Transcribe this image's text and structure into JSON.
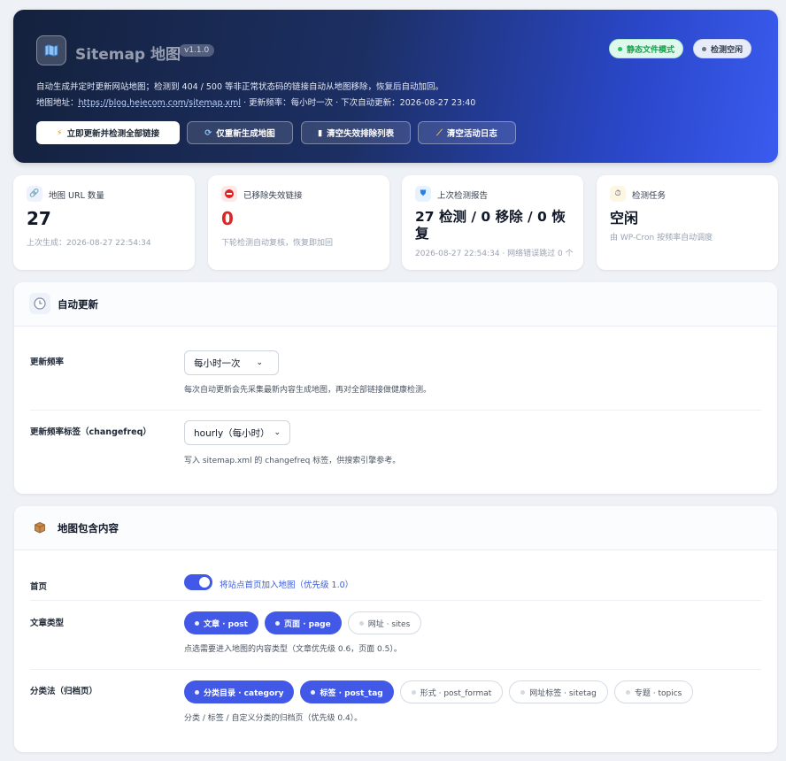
{
  "hero": {
    "title": "Sitemap 地图",
    "version": "v1.1.0",
    "badge_static": "静态文件模式",
    "badge_idle": "检测空闲",
    "description": "自动生成并定时更新网站地图；检测到 404 / 500 等非正常状态码的链接自动从地图移除，恢复后自动加回。",
    "meta_prefix": "地图地址：",
    "sitemap_url": "https://blog.heiecom.com/sitemap.xml",
    "meta_suffix": " · 更新频率：每小时一次 · 下次自动更新：2026-08-27 23:40",
    "btn_update": "立即更新并检测全部链接",
    "btn_regen": "仅重新生成地图",
    "btn_clear_invalid": "清空失效排除列表",
    "btn_clear_log": "清空活动日志"
  },
  "stats": [
    {
      "label": "地图 URL 数量",
      "value": "27",
      "sub": "上次生成：2026-08-27 22:54:34"
    },
    {
      "label": "已移除失效链接",
      "value": "0",
      "sub": "下轮检测自动复核，恢复即加回"
    },
    {
      "label": "上次检测报告",
      "value": "27 检测 / 0 移除 / 0 恢复",
      "sub": "2026-08-27 22:54:34 · 网络错误跳过 0 个"
    },
    {
      "label": "检测任务",
      "value": "空闲",
      "sub": "由 WP-Cron 按频率自动调度"
    }
  ],
  "auto_update": {
    "title": "自动更新",
    "freq_label": "更新频率",
    "freq_value": "每小时一次",
    "freq_help": "每次自动更新会先采集最新内容生成地图，再对全部链接做健康检测。",
    "changefreq_label": "更新频率标签（changefreq）",
    "changefreq_value": "hourly（每小时）",
    "changefreq_help": "写入 sitemap.xml 的 changefreq 标签，供搜索引擎参考。"
  },
  "content": {
    "title": "地图包含内容",
    "home_label": "首页",
    "home_toggle_label": "将站点首页加入地图（优先级 1.0）",
    "home_toggle_on": true,
    "post_types_label": "文章类型",
    "post_types": [
      {
        "label": "文章 · post",
        "on": true
      },
      {
        "label": "页面 · page",
        "on": true
      },
      {
        "label": "网址 · sites",
        "on": false
      }
    ],
    "post_types_help": "点选需要进入地图的内容类型（文章优先级 0.6，页面 0.5）。",
    "tax_label": "分类法（归档页）",
    "taxonomies": [
      {
        "label": "分类目录 · category",
        "on": true
      },
      {
        "label": "标签 · post_tag",
        "on": true
      },
      {
        "label": "形式 · post_format",
        "on": false
      },
      {
        "label": "网址标签 · sitetag",
        "on": false
      },
      {
        "label": "专题 · topics",
        "on": false
      }
    ],
    "tax_help": "分类 / 标签 / 自定义分类的归档页（优先级 0.4）。"
  },
  "colors": {
    "accent": "#4159e6",
    "success": "#16a34a",
    "danger": "#dc2626"
  }
}
